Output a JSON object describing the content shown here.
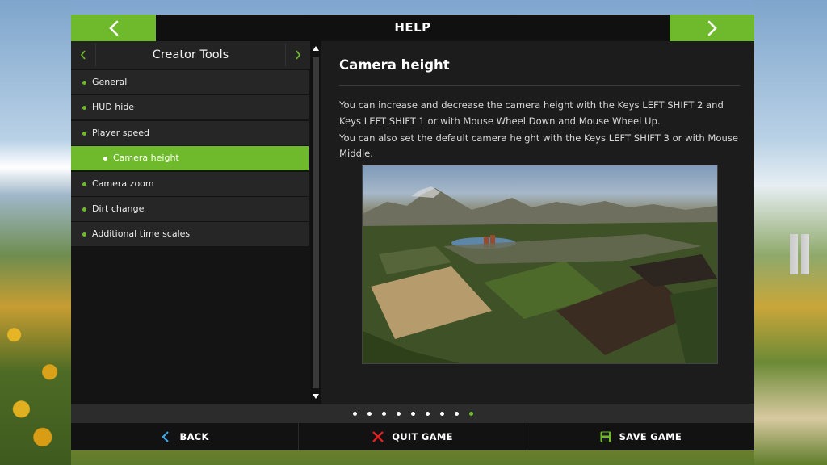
{
  "header": {
    "title": "HELP"
  },
  "category": {
    "title": "Creator Tools"
  },
  "sidebar": {
    "items": [
      {
        "label": "General"
      },
      {
        "label": "HUD hide"
      },
      {
        "label": "Player speed"
      },
      {
        "label": "Camera height"
      },
      {
        "label": "Camera zoom"
      },
      {
        "label": "Dirt change"
      },
      {
        "label": "Additional time scales"
      }
    ]
  },
  "content": {
    "title": "Camera height",
    "paragraphs": [
      "You can increase and decrease the camera height with the Keys LEFT SHIFT 2 and Keys LEFT SHIFT 1 or with Mouse Wheel Down and Mouse Wheel Up.",
      "You can also set the default camera height with the Keys LEFT SHIFT 3 or with Mouse Middle."
    ]
  },
  "pagination": {
    "total_pages": 9,
    "current_page": 9
  },
  "footer": {
    "back_label": "BACK",
    "quit_label": "QUIT GAME",
    "save_label": "SAVE GAME"
  },
  "colors": {
    "accent": "#6fba2c",
    "quit_icon": "#e02020",
    "panel": "#1c1c1c"
  },
  "icons": {
    "prev": "chevron-left-icon",
    "next": "chevron-right-icon",
    "back": "chevron-left-icon",
    "quit": "close-icon",
    "save": "floppy-disk-icon"
  }
}
